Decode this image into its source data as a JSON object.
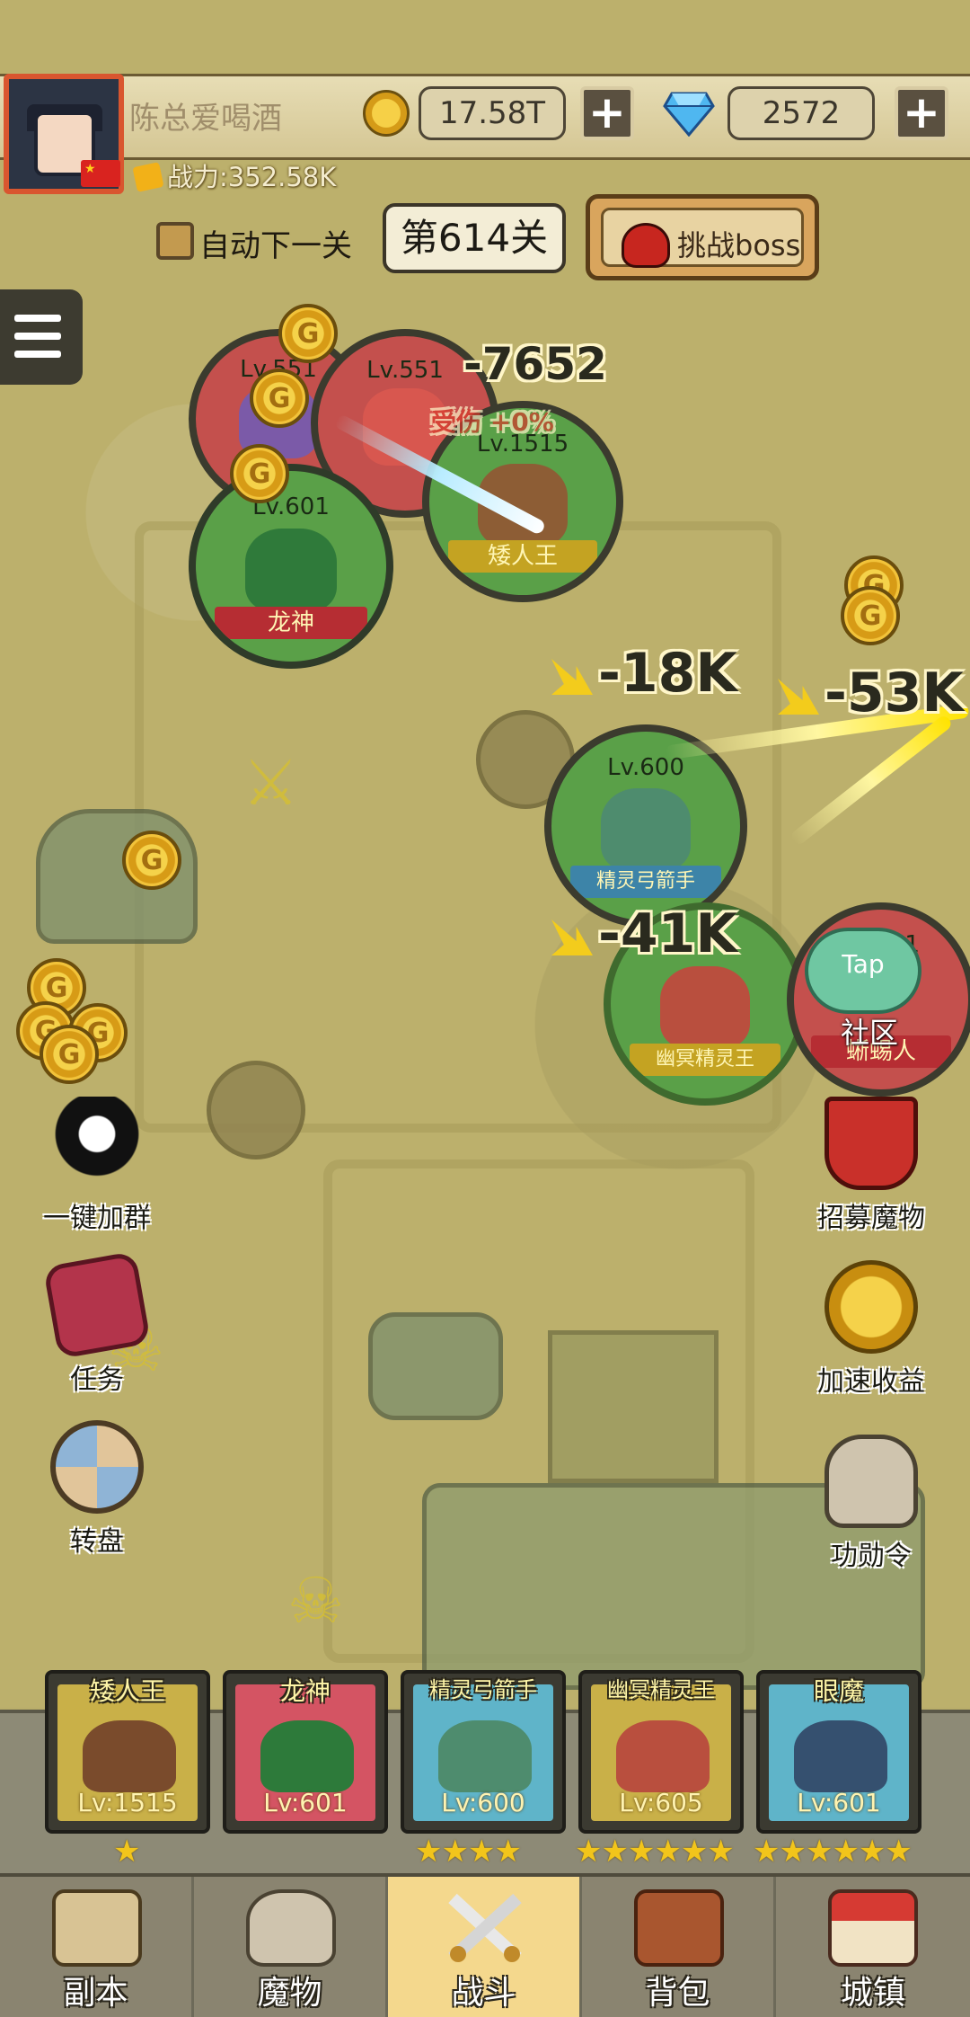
{
  "player": {
    "name": "陈总爱喝酒",
    "power": "战力:352.58K",
    "gold": "17.58T",
    "gems": "2572"
  },
  "stage": {
    "auto_next_label": "自动下一关",
    "auto_next_checked": true,
    "current": "第614关",
    "boss_button": "挑战boss"
  },
  "battlefield": {
    "monsters": [
      {
        "id": "wolf",
        "level": "Lv.551",
        "name": "",
        "hp_color": "#c4504d"
      },
      {
        "id": "serpent",
        "level": "Lv.551",
        "name": "",
        "hp_color": "#c4504d"
      },
      {
        "id": "dwarf-king",
        "level": "Lv.1515",
        "name": "矮人王"
      },
      {
        "id": "dragon-god",
        "level": "Lv.601",
        "name": "龙神"
      },
      {
        "id": "elf-archer",
        "level": "Lv.600",
        "name": "精灵弓箭手"
      },
      {
        "id": "dark-elf-king",
        "level": "",
        "name": "幽冥精灵王"
      },
      {
        "id": "lizardman",
        "level": "Lv.551",
        "name": "蜥蜴人"
      }
    ],
    "damage_numbers": [
      "-7652",
      "-18K",
      "-53K",
      "-41K"
    ],
    "buff_text": "受伤 +0%",
    "tap_label": "Tap",
    "community_label": "社区"
  },
  "left_actions": [
    {
      "id": "join-group",
      "icon": "qq-penguin-icon",
      "label": "一键加群"
    },
    {
      "id": "quest",
      "icon": "book-icon",
      "label": "任务"
    },
    {
      "id": "wheel",
      "icon": "wheel-icon",
      "label": "转盘"
    }
  ],
  "right_actions": [
    {
      "id": "recruit",
      "icon": "banner-icon",
      "label": "招募魔物"
    },
    {
      "id": "speed-up",
      "icon": "gold-boost-icon",
      "label": "加速收益"
    },
    {
      "id": "merit",
      "icon": "helmet-icon",
      "label": "功勋令"
    }
  ],
  "team": [
    {
      "name": "矮人王",
      "level": "Lv:1515",
      "stars": 1,
      "bg": "#c9b048"
    },
    {
      "name": "龙神",
      "level": "Lv:601",
      "stars": 4,
      "bg": "#d45463"
    },
    {
      "name": "精灵弓箭手",
      "level": "Lv:600",
      "stars": 4,
      "bg": "#5fb4c9"
    },
    {
      "name": "幽冥精灵王",
      "level": "Lv:605",
      "stars": 6,
      "bg": "#c9b048"
    },
    {
      "name": "眼魔",
      "level": "Lv:601",
      "stars": 6,
      "bg": "#5fb4c9"
    }
  ],
  "nav": {
    "tabs": [
      {
        "id": "dungeon",
        "label": "副本",
        "icon": "map-icon"
      },
      {
        "id": "monsters",
        "label": "魔物",
        "icon": "helmet-icon"
      },
      {
        "id": "battle",
        "label": "战斗",
        "icon": "swords-icon",
        "active": true
      },
      {
        "id": "bag",
        "label": "背包",
        "icon": "backpack-icon"
      },
      {
        "id": "town",
        "label": "城镇",
        "icon": "shop-icon"
      }
    ]
  },
  "colors": {
    "accent_gold": "#f2c51b",
    "hp_green": "#4fab3e",
    "hp_red": "#c4504d",
    "active_tab": "#f4d88d"
  }
}
